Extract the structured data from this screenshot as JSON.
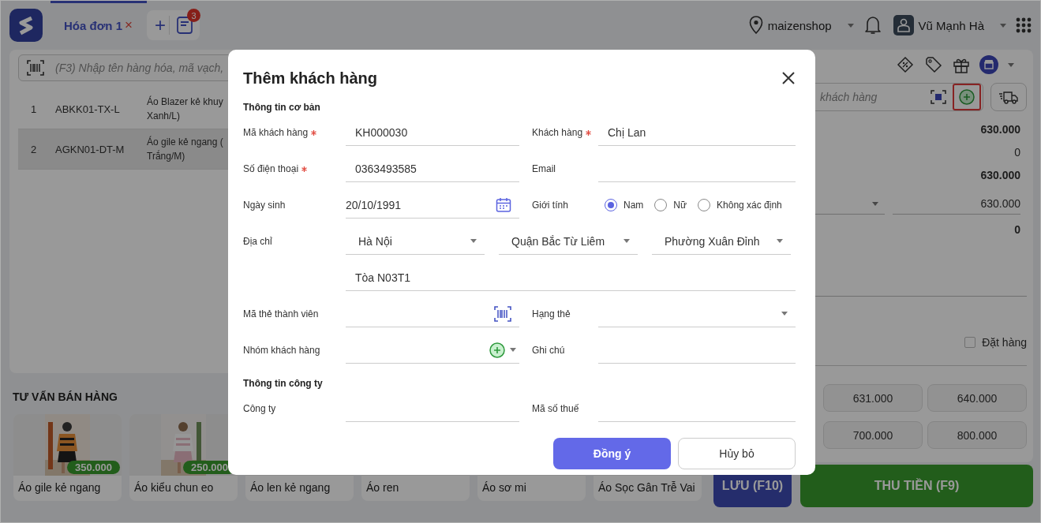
{
  "topbar": {
    "tabs": [
      {
        "label": "Hóa đơn 1",
        "close": "×",
        "selected": true
      }
    ],
    "add_tab": "+",
    "pending_count": "3",
    "store": "maizenshop",
    "user": "Vũ Mạnh Hà"
  },
  "cart": {
    "search": {
      "placeholder": "(F3) Nhập tên hàng hóa, mã vạch,"
    },
    "rows": [
      {
        "index": "1",
        "code": "ABKK01-TX-L",
        "name": [
          "Áo Blazer kẻ khuy",
          "Xanh/L)"
        ],
        "selected": false
      },
      {
        "index": "2",
        "code": "AGKN01-DT-M",
        "name": [
          "Áo gile kẻ ngang (",
          "Trắng/M)"
        ],
        "selected": true
      }
    ]
  },
  "suggestions": {
    "title": "TƯ VẤN BÁN HÀNG",
    "products": [
      {
        "name": "Áo gile kẻ ngang",
        "price": "350.000"
      },
      {
        "name": "Áo kiểu chun eo",
        "price": "250.000"
      },
      {
        "name": "Áo len kẻ ngang"
      },
      {
        "name": "Áo ren"
      },
      {
        "name": "Áo sơ mi"
      },
      {
        "name": "Áo Sọc Gân Trễ Vai"
      }
    ]
  },
  "payment": {
    "customer_search": {
      "placeholder": "khách hàng"
    },
    "add_customer": {
      "highlighted": true
    },
    "summary": [
      {
        "kind": "text",
        "value": "630.000",
        "bold": true
      },
      {
        "kind": "text",
        "value": "0",
        "bold": false
      },
      {
        "kind": "text",
        "value": "630.000",
        "bold": true
      },
      {
        "kind": "field",
        "value": "630.000",
        "bold": false
      },
      {
        "kind": "text",
        "value": "0",
        "bold": true
      }
    ],
    "order_checkbox": {
      "label": "Đặt hàng",
      "checked": false
    },
    "quick_amounts": [
      "631.000",
      "640.000",
      "700.000",
      "800.000"
    ],
    "buttons": [
      {
        "label": "LƯU (F10)",
        "kind": "save"
      },
      {
        "label": "THU TIỀN (F9)",
        "kind": "pay"
      }
    ]
  },
  "modal": {
    "title": "Thêm khách hàng",
    "sections": [
      {
        "title": "Thông tin cơ bản",
        "rows": [
          {
            "fields": [
              {
                "label": "Mã khách hàng",
                "required": true,
                "kind": "text",
                "value": "KH000030"
              },
              {
                "label": "Khách hàng",
                "required": true,
                "kind": "text",
                "value": "Chị Lan"
              }
            ]
          },
          {
            "fields": [
              {
                "label": "Số điện thoại",
                "required": true,
                "kind": "text",
                "value": "0363493585"
              },
              {
                "label": "Email",
                "required": false,
                "kind": "text"
              }
            ]
          },
          {
            "fields": [
              {
                "label": "Ngày sinh",
                "required": false,
                "kind": "date",
                "value": "20/10/1991"
              },
              {
                "label": "Giới tính",
                "required": false,
                "kind": "radio",
                "options": [
                  {
                    "label": "Nam",
                    "selected": true
                  },
                  {
                    "label": "Nữ",
                    "selected": false
                  },
                  {
                    "label": "Không xác định",
                    "selected": false
                  }
                ]
              }
            ]
          },
          {
            "fields": [
              {
                "label": "Địa chỉ",
                "required": false,
                "kind": "address",
                "selects": [
                  "Hà Nội",
                  "Quận Bắc Từ Liêm",
                  "Phường Xuân Đỉnh"
                ],
                "value": "Tòa N03T1"
              }
            ]
          },
          {
            "fields": [
              {
                "label": "Mã thẻ thành viên",
                "required": false,
                "kind": "scan"
              },
              {
                "label": "Hạng thẻ",
                "required": false,
                "kind": "select"
              }
            ]
          },
          {
            "fields": [
              {
                "label": "Nhóm khách hàng",
                "required": false,
                "kind": "group"
              },
              {
                "label": "Ghi chú",
                "required": false,
                "kind": "text"
              }
            ]
          }
        ]
      },
      {
        "title": "Thông tin công ty",
        "rows": [
          {
            "fields": [
              {
                "label": "Công ty",
                "required": false,
                "kind": "text"
              },
              {
                "label": "Mã số thuế",
                "required": false,
                "kind": "text"
              }
            ]
          }
        ]
      }
    ],
    "buttons": [
      {
        "label": "Đồng ý",
        "kind": "primary"
      },
      {
        "label": "Hủy bỏ",
        "kind": "secondary"
      }
    ]
  }
}
